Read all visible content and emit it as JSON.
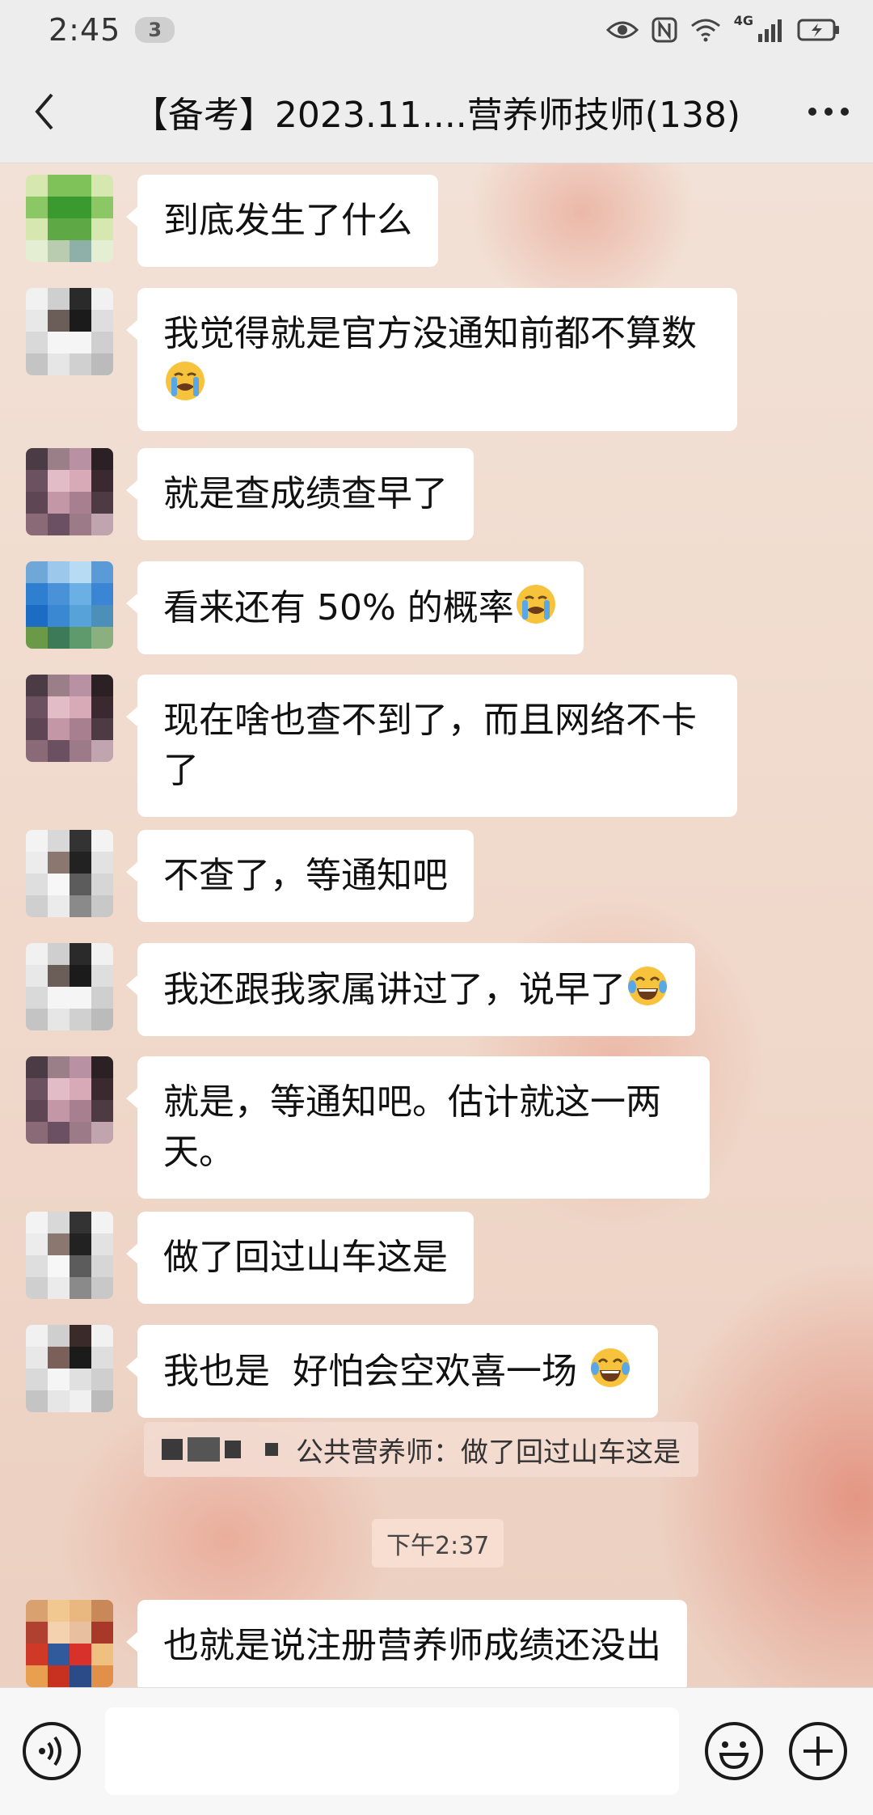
{
  "status_bar": {
    "time": "2:45",
    "notification_count": "3",
    "network_label": "4G"
  },
  "header": {
    "title": "【备考】2023.11....营养师技师(138)",
    "back_icon": "chevron-left-icon",
    "more_icon": "more-horizontal-icon"
  },
  "messages": [
    {
      "text": "到底发生了什么",
      "emoji": ""
    },
    {
      "text": "我觉得就是官方没通知前都不算数",
      "emoji": "loudly-crying-face"
    },
    {
      "text": "就是查成绩查早了",
      "emoji": ""
    },
    {
      "text": "看来还有 50% 的概率",
      "emoji": "loudly-crying-face"
    },
    {
      "text": "现在啥也查不到了，而且网络不卡了",
      "emoji": ""
    },
    {
      "text": "不查了，等通知吧",
      "emoji": ""
    },
    {
      "text": "我还跟我家属讲过了，说早了",
      "emoji": "face-with-tears-of-joy"
    },
    {
      "text": "就是，等通知吧。估计就这一两天。",
      "emoji": ""
    },
    {
      "text": "做了回过山车这是",
      "emoji": ""
    },
    {
      "text": "我也是  好怕会空欢喜一场 ",
      "emoji": "face-with-tears-of-joy"
    },
    {
      "text": "也就是说注册营养师成绩还没出",
      "emoji": ""
    }
  ],
  "quote": {
    "text": "公共营养师：做了回过山车这是"
  },
  "time_separator": "下午2:37",
  "input_bar": {
    "placeholder": "",
    "voice_icon": "voice-icon",
    "emoji_icon": "emoji-icon",
    "plus_icon": "plus-icon"
  },
  "colors": {
    "bubble": "#ffffff",
    "header_bg": "#ededed",
    "chat_bg": "#f0d9cb"
  }
}
